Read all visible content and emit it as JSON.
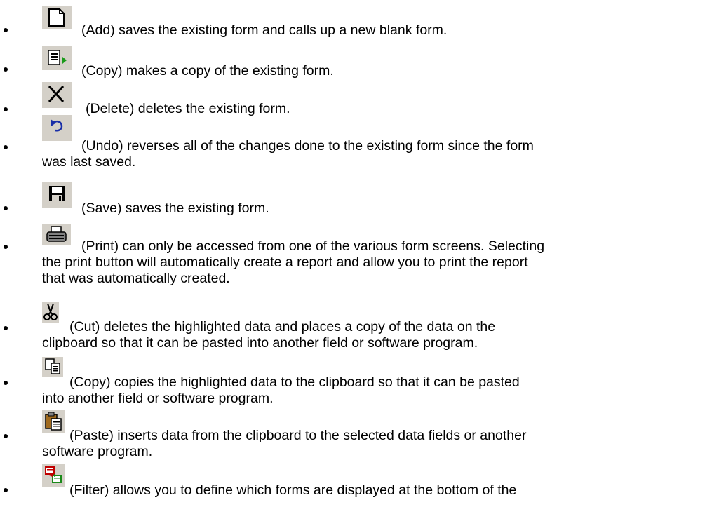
{
  "items": [
    {
      "icon": "add-icon",
      "lines": [
        "(Add) saves the existing form and calls up a new blank form."
      ]
    },
    {
      "icon": "copy-form-icon",
      "lines": [
        "(Copy) makes a copy of the existing form."
      ]
    },
    {
      "icon": "delete-icon",
      "lines": [
        "(Delete) deletes the existing form."
      ]
    },
    {
      "icon": "undo-icon",
      "lines": [
        "(Undo) reverses all of the changes done to the existing form since the form",
        "was last saved."
      ]
    },
    {
      "icon": "save-icon",
      "lines": [
        "(Save) saves the existing form."
      ]
    },
    {
      "icon": "print-icon",
      "lines": [
        "(Print) can only be accessed from one of the various form screens.  Selecting",
        "the print button will automatically create a report and allow you to print the report",
        "that was automatically created."
      ]
    },
    {
      "icon": "cut-icon",
      "lines": [
        "(Cut) deletes the highlighted data and places a copy of the data on the",
        "clipboard so that it can be pasted into another field or software program."
      ]
    },
    {
      "icon": "copy-icon",
      "lines": [
        "(Copy) copies the highlighted data to the clipboard so that it can be pasted",
        "into another field or software program."
      ]
    },
    {
      "icon": "paste-icon",
      "lines": [
        "(Paste) inserts data from the clipboard to the selected data fields or another",
        "software program."
      ]
    },
    {
      "icon": "filter-icon",
      "lines": [
        "(Filter) allows you to define which forms are displayed at the bottom of the"
      ]
    }
  ]
}
